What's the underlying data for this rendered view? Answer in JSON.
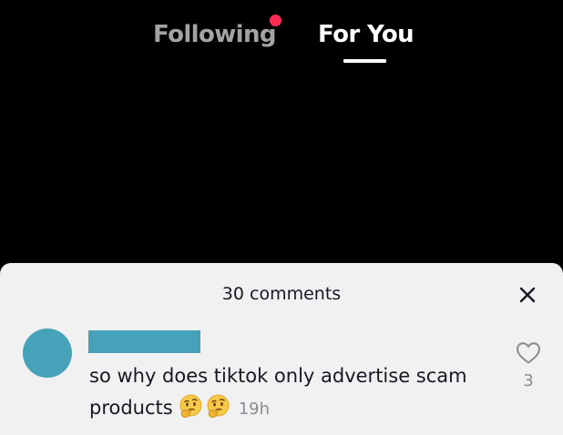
{
  "top_tabs": {
    "following_label": "Following",
    "for_you_label": "For You",
    "active_tab": "For You",
    "notification_dot_color": "#fe2c55"
  },
  "comments_sheet": {
    "title": "30 comments",
    "close_icon": "close-icon",
    "comments": [
      {
        "avatar_color": "#45a2b8",
        "username_redaction_color": "#45a2b8",
        "text": "so why does tiktok only advertise scam products",
        "emojis": [
          "thinking-face-emoji",
          "thinking-face-emoji"
        ],
        "timestamp": "19h",
        "like_icon": "heart-outline-icon",
        "like_count": "3"
      }
    ]
  },
  "colors": {
    "background": "#000000",
    "sheet_background": "#f1f1f2",
    "tab_inactive": "#a3a3a3",
    "tab_active": "#ffffff",
    "secondary_text": "#8a8b91",
    "primary_text": "#161823"
  }
}
